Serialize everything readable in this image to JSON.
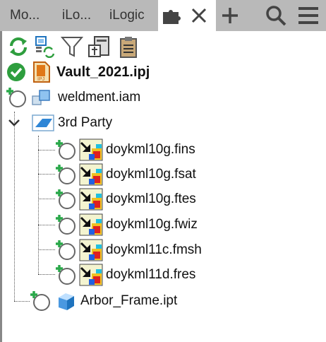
{
  "tabs": [
    {
      "label": "Mo..."
    },
    {
      "label": "iLo..."
    },
    {
      "label": "iLogic"
    }
  ],
  "toolbar": {
    "icons": [
      "refresh-icon",
      "project-settings-icon",
      "filter-icon",
      "server-icon",
      "clipboard-icon"
    ]
  },
  "tree": {
    "root": {
      "label": "Vault_2021.ipj",
      "status": "checked-in"
    },
    "assembly": {
      "label": "weldment.iam"
    },
    "folder": {
      "label": "3rd Party"
    },
    "files": [
      {
        "label": "doykml10g.fins"
      },
      {
        "label": "doykml10g.fsat"
      },
      {
        "label": "doykml10g.ftes"
      },
      {
        "label": "doykml10g.fwiz"
      },
      {
        "label": "doykml11c.fmsh"
      },
      {
        "label": "doykml11d.fres"
      }
    ],
    "part": {
      "label": "Arbor_Frame.ipt"
    }
  },
  "colors": {
    "tabbar": "#b9b9b9",
    "check": "#2e9e3e",
    "plus": "#2aa84a",
    "accent": "#1e73be"
  }
}
